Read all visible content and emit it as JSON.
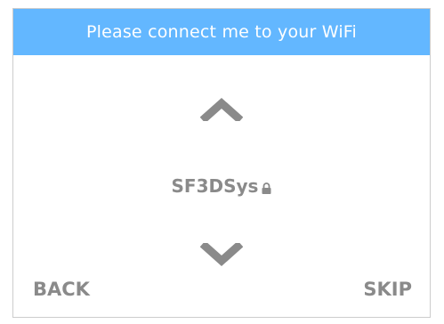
{
  "header": {
    "title": "Please connect me to your WiFi"
  },
  "network": {
    "ssid": "SF3DSys",
    "secured_icon": "lock-icon"
  },
  "navigation": {
    "prev_icon": "chevron-up-icon",
    "next_icon": "chevron-down-icon",
    "back_label": "BACK",
    "skip_label": "SKIP"
  },
  "colors": {
    "header_bg": "#63b7ff",
    "header_text": "#ffffff",
    "control_gray": "#8a8a8a"
  }
}
